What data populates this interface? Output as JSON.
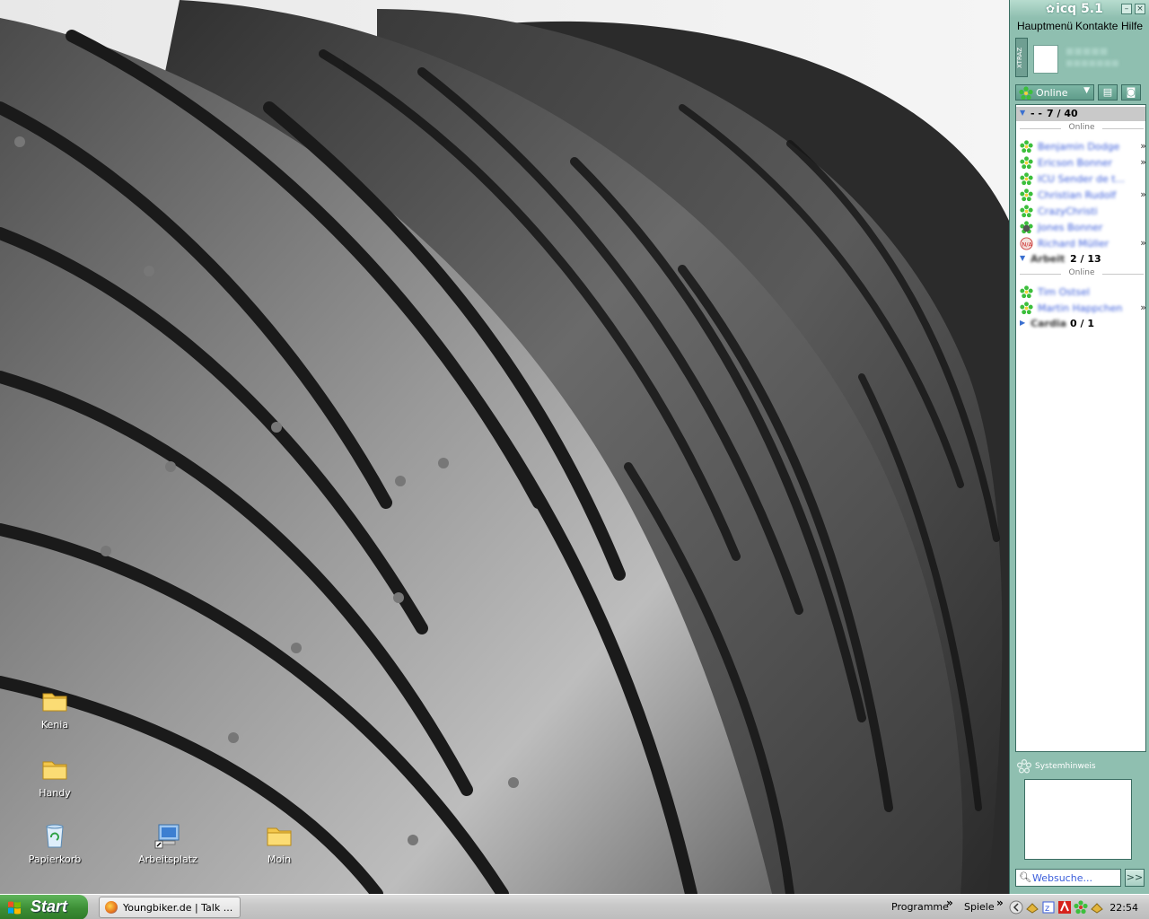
{
  "desktop": {
    "icons": [
      {
        "label": "Kenia",
        "icon": "folder-icon"
      },
      {
        "label": "Handy",
        "icon": "folder-icon"
      },
      {
        "label": "Papierkorb",
        "icon": "recycle-bin-icon"
      },
      {
        "label": "Arbeitsplatz",
        "icon": "my-computer-icon"
      },
      {
        "label": "Moin",
        "icon": "folder-icon"
      }
    ]
  },
  "icq": {
    "logo": "icq 5.1",
    "menu": [
      "Hauptmenü",
      "Kontakte",
      "Hilfe"
    ],
    "xtraz": "XTRAZ",
    "status": "Online",
    "groups": [
      {
        "name": "- -",
        "count": "7 / 40",
        "sub": "Online",
        "contacts": [
          {
            "name": "Benjamin Dodge",
            "more": "»",
            "icon": "online-flower-icon"
          },
          {
            "name": "Ericson Bonner",
            "more": "»",
            "icon": "online-flower-icon"
          },
          {
            "name": "ICU Sender de t...",
            "more": "",
            "icon": "online-flower-icon"
          },
          {
            "name": "Christian Rudolf",
            "more": "»",
            "icon": "online-flower-icon"
          },
          {
            "name": "CrazyChristi",
            "more": "",
            "icon": "online-flower-icon"
          },
          {
            "name": "Jones Bonner",
            "more": "",
            "icon": "occupied-flower-icon"
          },
          {
            "name": "Richard Müller",
            "more": "»",
            "icon": "na-status-icon"
          }
        ]
      },
      {
        "name": "Arbeit",
        "count": "2 / 13",
        "sub": "Online",
        "contacts": [
          {
            "name": "Tim Ostsel",
            "more": "",
            "icon": "online-flower-icon"
          },
          {
            "name": "Martin Happchen",
            "more": "»",
            "icon": "online-flower-icon"
          }
        ]
      },
      {
        "name": "Cardia",
        "count": "0 / 1",
        "sub": "",
        "contacts": []
      }
    ],
    "notice_title": "Systemhinweis",
    "search_placeholder": "Websuche...",
    "search_go": ">>"
  },
  "taskbar": {
    "start_label": "Start",
    "task_label": "Youngbiker.de | Talk ...",
    "links": [
      "Programme",
      "Spiele"
    ],
    "chevron": "»",
    "clock": "22:54"
  },
  "colors": {
    "icq_accent": "#8fbfb0",
    "contact_link": "#3a5ddb",
    "start_green": "#3c8e35"
  }
}
